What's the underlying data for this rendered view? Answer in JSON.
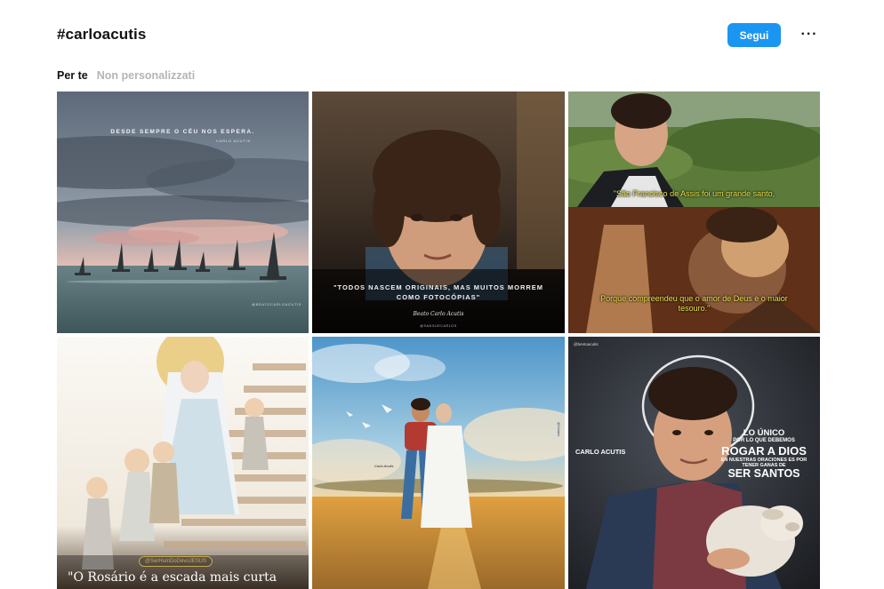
{
  "header": {
    "title": "#carloacutis",
    "follow_label": "Segui",
    "more_label": "···"
  },
  "tabs": [
    {
      "label": "Per te"
    },
    {
      "label": "Non personalizzati"
    }
  ],
  "grid": {
    "tiles": [
      {
        "quote": "DESDE SEMPRE O CÉU NOS ESPERA.",
        "sign": "CARLO ACUTIS",
        "handle": "@BEATOCARLOACUTIS"
      },
      {
        "quote": "\"TODOS NASCEM ORIGINAIS, MAS MUITOS MORREM COMO FOTOCÓPIAS\"",
        "sign": "Beato Carlo Acutis",
        "handle": "@SANGUECARLOS"
      },
      {
        "caption_top": "\"São Francisco de Assis foi um grande santo,",
        "caption_bottom": "Porque compreendeu que o amor de Deus é o maior tesouro.\""
      },
      {
        "handle": "@SerHumDoDevoJESUS",
        "caption": "\"O Rosário é a escada mais curta"
      },
      {
        "signature": "Carlo Acutis",
        "side_text": "@Solaris"
      },
      {
        "handle": "@bentoacutis",
        "name": "CARLO ACUTIS",
        "lines": [
          "LO ÚNICO",
          "POR LO QUE DEBEMOS",
          "ROGAR A DIOS",
          "EN NUESTRAS ORACIONES ES POR TENER GANAS DE",
          "SER SANTOS"
        ]
      }
    ]
  }
}
